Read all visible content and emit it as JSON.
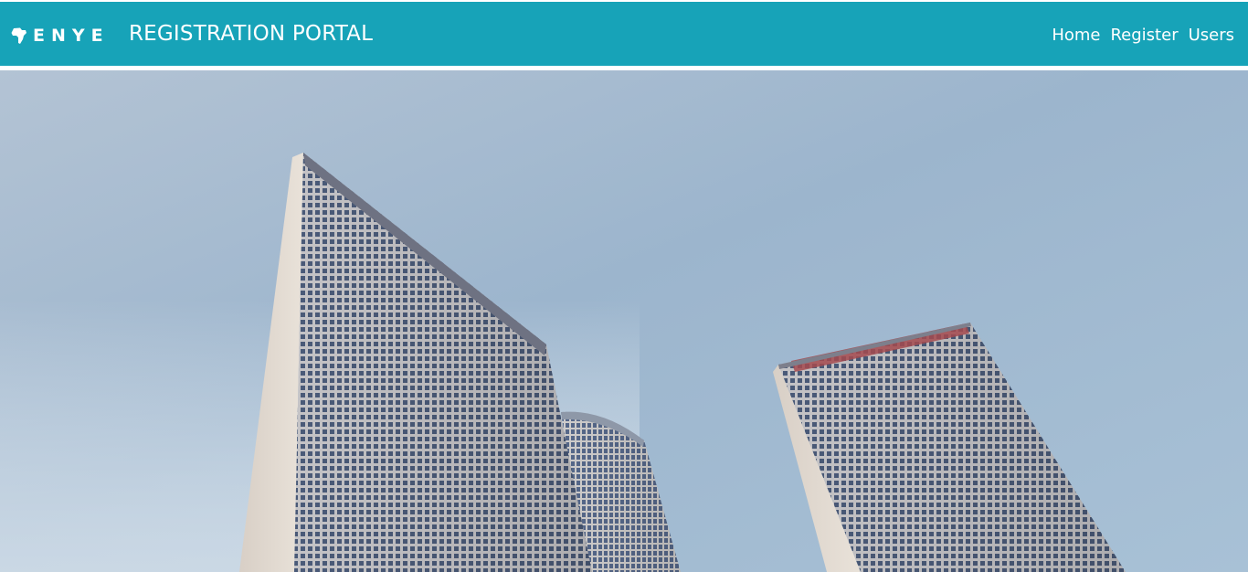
{
  "header": {
    "brand_text": "ENYE",
    "portal_title": "REGISTRATION PORTAL",
    "nav": [
      {
        "label": "Home"
      },
      {
        "label": "Register"
      },
      {
        "label": "Users"
      }
    ]
  },
  "hero": {
    "image_name": "skyscrapers-photo"
  },
  "colors": {
    "navbar": "#17a3b8",
    "text": "#ffffff",
    "sky": "#9db7cf",
    "building_face": "#c9c3bc"
  }
}
